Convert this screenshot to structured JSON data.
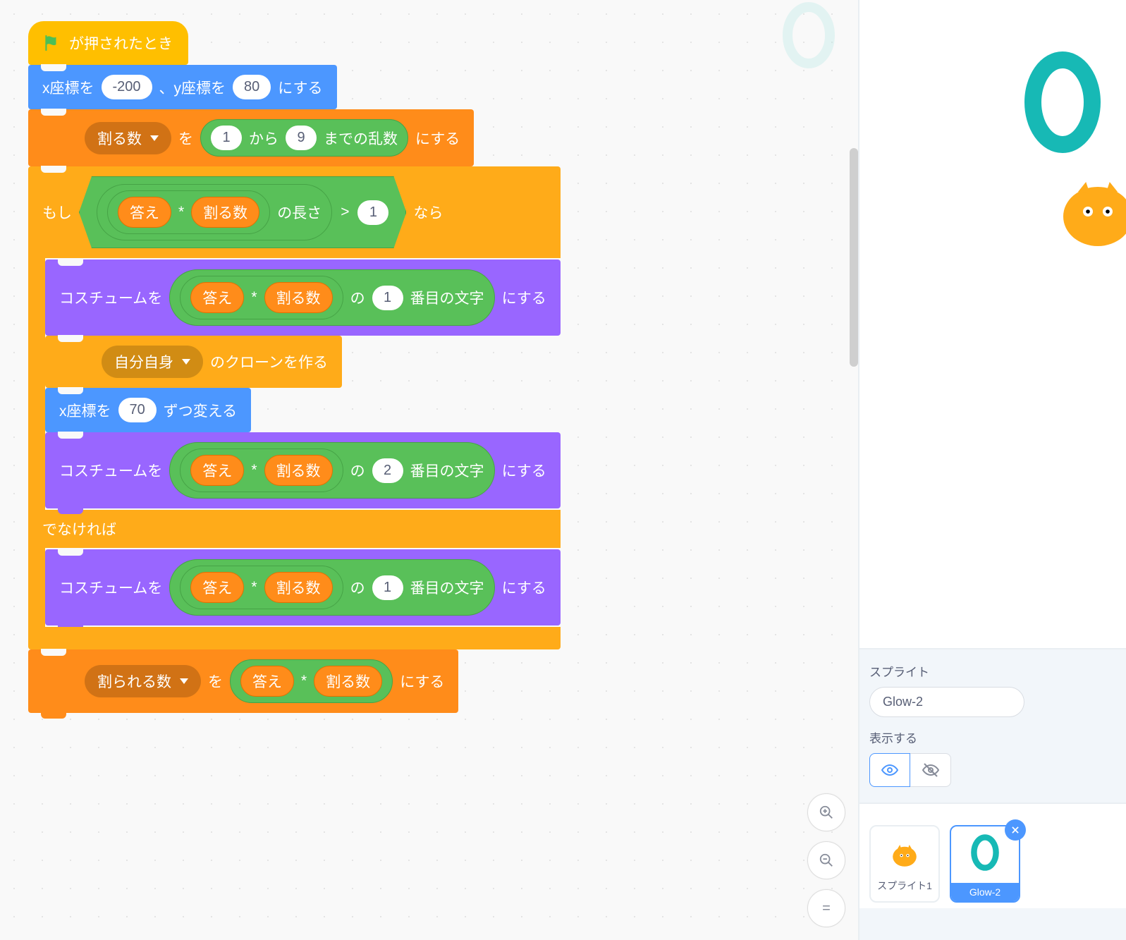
{
  "hat": {
    "label": "が押されたとき"
  },
  "blocks": {
    "goto": {
      "pre": "x座標を",
      "x": "-200",
      "mid": "、y座標を",
      "y": "80",
      "post": "にする"
    },
    "set_divisor": {
      "dropdown": "割る数",
      "word_to": "を",
      "rand_from": "1",
      "rand_mid": "から",
      "rand_to": "9",
      "rand_post": "までの乱数",
      "post": "にする"
    },
    "if": {
      "if_word": "もし",
      "then_word": "なら",
      "else_word": "でなければ",
      "cond": {
        "ans": "答え",
        "star": "*",
        "div": "割る数",
        "len": "の長さ",
        "gt": ">",
        "one": "1"
      },
      "costume1": {
        "pre": "コスチュームを",
        "ans": "答え",
        "star": "*",
        "div": "割る数",
        "of": "の",
        "idx": "1",
        "letter": "番目の文字",
        "post": "にする"
      },
      "clone": {
        "dropdown": "自分自身",
        "post": "のクローンを作る"
      },
      "changex": {
        "pre": "x座標を",
        "val": "70",
        "post": "ずつ変える"
      },
      "costume2": {
        "pre": "コスチュームを",
        "ans": "答え",
        "star": "*",
        "div": "割る数",
        "of": "の",
        "idx": "2",
        "letter": "番目の文字",
        "post": "にする"
      },
      "costume_else": {
        "pre": "コスチュームを",
        "ans": "答え",
        "star": "*",
        "div": "割る数",
        "of": "の",
        "idx": "1",
        "letter": "番目の文字",
        "post": "にする"
      }
    },
    "set_dividend": {
      "dropdown": "割られる数",
      "word_to": "を",
      "ans": "答え",
      "star": "*",
      "div": "割る数",
      "post": "にする"
    }
  },
  "zoom": {
    "in": "+",
    "out": "−",
    "eq": "="
  },
  "sprite_panel": {
    "label": "スプライト",
    "name": "Glow-2",
    "show_label": "表示する"
  },
  "sprites": {
    "s1": "スプライト1",
    "s2": "Glow-2"
  }
}
